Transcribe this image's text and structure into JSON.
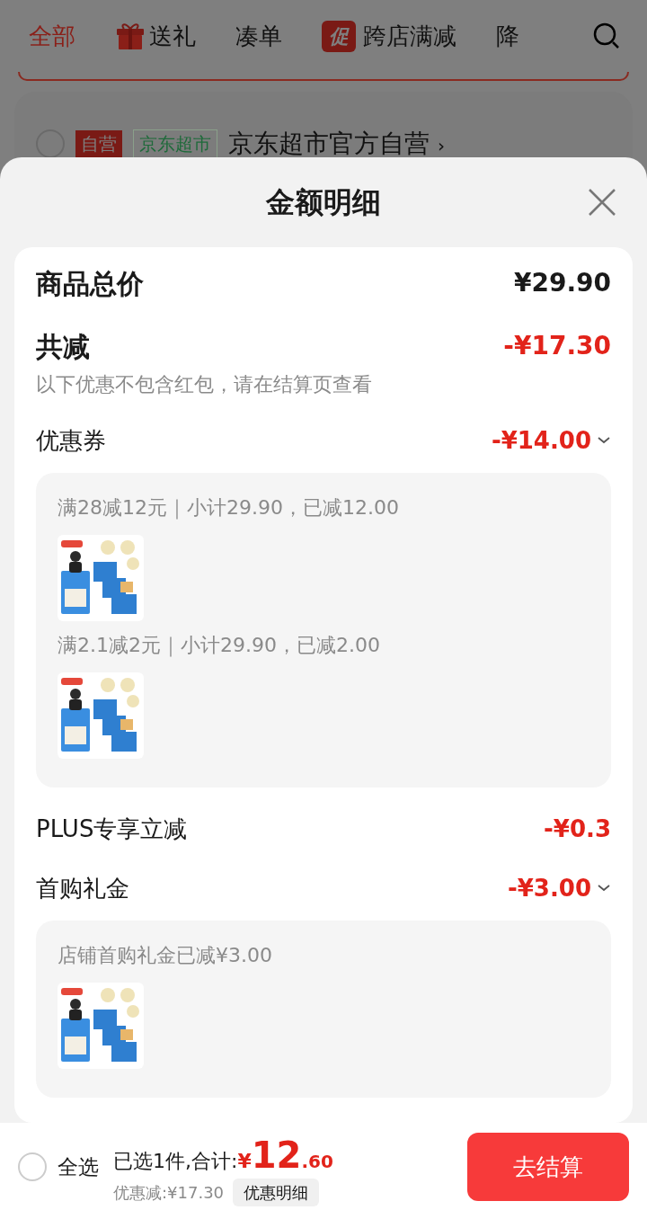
{
  "background": {
    "tabs": [
      {
        "label": "全部",
        "selected": true,
        "kind": "plain"
      },
      {
        "label": "送礼",
        "selected": false,
        "kind": "gift"
      },
      {
        "label": "凑单",
        "selected": false,
        "kind": "plain"
      },
      {
        "label": "跨店满减",
        "selected": false,
        "kind": "promo",
        "icon_text": "促"
      },
      {
        "label": "降",
        "selected": false,
        "kind": "plain"
      }
    ],
    "store": {
      "checked": false,
      "badges": [
        {
          "label": "自营",
          "kind": "solid"
        },
        {
          "label": "京东超市",
          "kind": "outline"
        }
      ],
      "name": "京东超市官方自营",
      "chevron": "›"
    }
  },
  "sheet": {
    "title": "金额明细",
    "total": {
      "label": "商品总价",
      "value": "¥29.90"
    },
    "reduction": {
      "label": "共减",
      "value": "-¥17.30",
      "note": "以下优惠不包含红包，请在结算页查看"
    },
    "rows": [
      {
        "kind": "expandable",
        "label": "优惠券",
        "value": "-¥14.00",
        "expanded": true,
        "groups": [
          {
            "text": "满28减12元｜小计29.90，已减12.00"
          },
          {
            "text": "满2.1减2元｜小计29.90，已减2.00"
          }
        ]
      },
      {
        "kind": "plain",
        "label": "PLUS专享立减",
        "value": "-¥0.3"
      },
      {
        "kind": "expandable",
        "label": "首购礼金",
        "value": "-¥3.00",
        "expanded": true,
        "groups": [
          {
            "text": "店铺首购礼金已减¥3.00"
          }
        ]
      }
    ]
  },
  "bottom": {
    "select_all": {
      "label": "全选",
      "checked": false
    },
    "summary": "已选1件,合计:",
    "currency": "¥",
    "integer": "12",
    "decimals": ".60",
    "discount": "优惠减:¥17.30",
    "detail_button": "优惠明细",
    "checkout": "去结算"
  }
}
